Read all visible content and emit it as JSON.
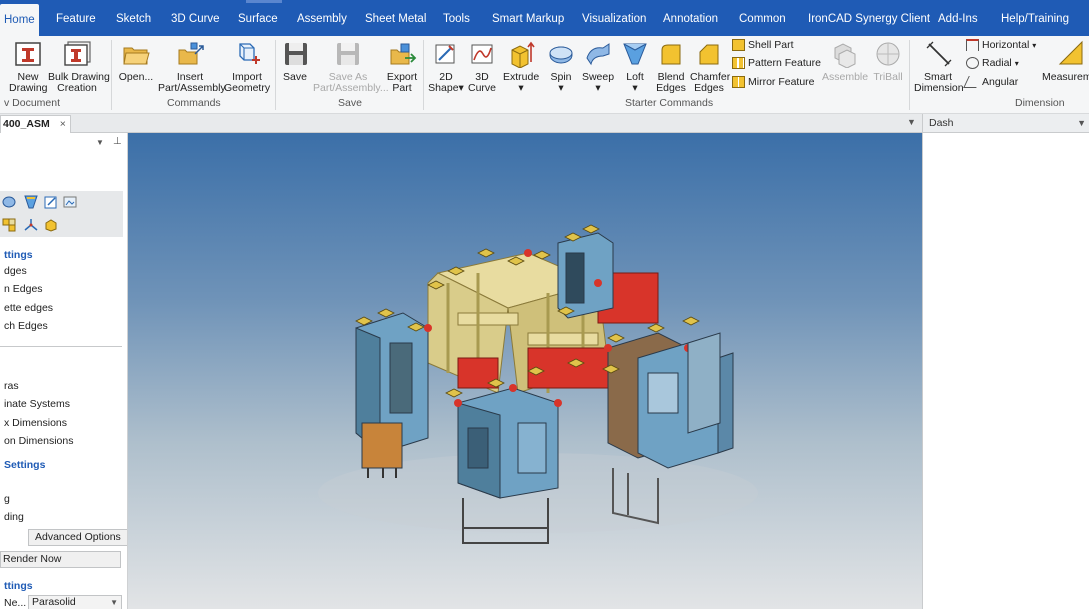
{
  "tabs": [
    "Home",
    "Feature",
    "Sketch",
    "3D Curve",
    "Surface",
    "Assembly",
    "Sheet Metal",
    "Tools",
    "Smart Markup",
    "Visualization",
    "Annotation",
    "Common",
    "IronCAD Synergy Client",
    "Add-Ins",
    "Help/Training"
  ],
  "ribbon": {
    "new_document": {
      "label": "v Document",
      "buttons": [
        "New\nDrawing",
        "Bulk Drawing\nCreation"
      ]
    },
    "commands": {
      "label": "Commands",
      "buttons": [
        "Open...",
        "Insert\nPart/Assembly",
        "Import\nGeometry"
      ]
    },
    "save": {
      "label": "Save",
      "buttons": [
        "Save",
        "Save As\nPart/Assembly...",
        "Export\nPart"
      ]
    },
    "starter": {
      "label": "Starter Commands",
      "buttons": [
        "2D\nShape",
        "3D\nCurve",
        "Extrude",
        "Spin",
        "Sweep",
        "Loft",
        "Blend\nEdges",
        "Chamfer\nEdges"
      ],
      "small": [
        "Shell Part",
        "Pattern Feature",
        "Mirror Feature"
      ],
      "disabled": [
        "Assemble",
        "TriBall"
      ]
    },
    "dimension": {
      "label": "Dimension",
      "smart": "Smart\nDimension",
      "small": [
        "Horizontal",
        "Radial",
        "Angular"
      ],
      "measure": "Measurem"
    }
  },
  "document": {
    "tab": "400_ASM",
    "close": "×"
  },
  "left_panel": {
    "settings_heading": "ttings",
    "items_a": [
      "dges",
      "n Edges",
      "ette edges",
      "ch Edges"
    ],
    "items_b": [
      "ras",
      "inate Systems",
      "x Dimensions",
      "on Dimensions"
    ],
    "render_heading": "Settings",
    "items_c": [
      "g",
      "ding"
    ],
    "advanced_button": "Advanced Options",
    "render_button": "Render Now",
    "export_heading": "ttings",
    "format_label": "Ne...",
    "format_value": "Parasolid"
  },
  "right_panel": {
    "title": "Dash"
  },
  "colors": {
    "accent": "#1f5bb5",
    "model_frame": "#e8dca0",
    "model_cabinet": "#6fa2c4",
    "model_red": "#d8342a",
    "model_brown": "#8a6a4a"
  }
}
